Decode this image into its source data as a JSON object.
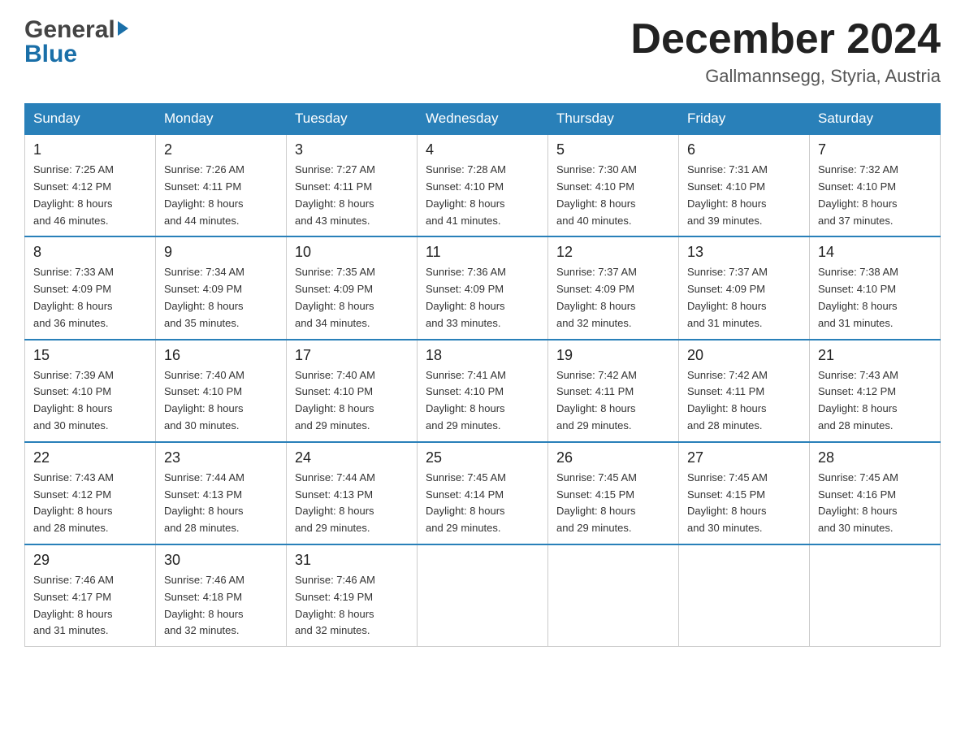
{
  "header": {
    "logo_text1": "General",
    "logo_text2": "Blue",
    "month_title": "December 2024",
    "location": "Gallmannsegg, Styria, Austria"
  },
  "days_of_week": [
    "Sunday",
    "Monday",
    "Tuesday",
    "Wednesday",
    "Thursday",
    "Friday",
    "Saturday"
  ],
  "weeks": [
    [
      {
        "day": "1",
        "sunrise": "7:25 AM",
        "sunset": "4:12 PM",
        "daylight": "8 hours and 46 minutes."
      },
      {
        "day": "2",
        "sunrise": "7:26 AM",
        "sunset": "4:11 PM",
        "daylight": "8 hours and 44 minutes."
      },
      {
        "day": "3",
        "sunrise": "7:27 AM",
        "sunset": "4:11 PM",
        "daylight": "8 hours and 43 minutes."
      },
      {
        "day": "4",
        "sunrise": "7:28 AM",
        "sunset": "4:10 PM",
        "daylight": "8 hours and 41 minutes."
      },
      {
        "day": "5",
        "sunrise": "7:30 AM",
        "sunset": "4:10 PM",
        "daylight": "8 hours and 40 minutes."
      },
      {
        "day": "6",
        "sunrise": "7:31 AM",
        "sunset": "4:10 PM",
        "daylight": "8 hours and 39 minutes."
      },
      {
        "day": "7",
        "sunrise": "7:32 AM",
        "sunset": "4:10 PM",
        "daylight": "8 hours and 37 minutes."
      }
    ],
    [
      {
        "day": "8",
        "sunrise": "7:33 AM",
        "sunset": "4:09 PM",
        "daylight": "8 hours and 36 minutes."
      },
      {
        "day": "9",
        "sunrise": "7:34 AM",
        "sunset": "4:09 PM",
        "daylight": "8 hours and 35 minutes."
      },
      {
        "day": "10",
        "sunrise": "7:35 AM",
        "sunset": "4:09 PM",
        "daylight": "8 hours and 34 minutes."
      },
      {
        "day": "11",
        "sunrise": "7:36 AM",
        "sunset": "4:09 PM",
        "daylight": "8 hours and 33 minutes."
      },
      {
        "day": "12",
        "sunrise": "7:37 AM",
        "sunset": "4:09 PM",
        "daylight": "8 hours and 32 minutes."
      },
      {
        "day": "13",
        "sunrise": "7:37 AM",
        "sunset": "4:09 PM",
        "daylight": "8 hours and 31 minutes."
      },
      {
        "day": "14",
        "sunrise": "7:38 AM",
        "sunset": "4:10 PM",
        "daylight": "8 hours and 31 minutes."
      }
    ],
    [
      {
        "day": "15",
        "sunrise": "7:39 AM",
        "sunset": "4:10 PM",
        "daylight": "8 hours and 30 minutes."
      },
      {
        "day": "16",
        "sunrise": "7:40 AM",
        "sunset": "4:10 PM",
        "daylight": "8 hours and 30 minutes."
      },
      {
        "day": "17",
        "sunrise": "7:40 AM",
        "sunset": "4:10 PM",
        "daylight": "8 hours and 29 minutes."
      },
      {
        "day": "18",
        "sunrise": "7:41 AM",
        "sunset": "4:10 PM",
        "daylight": "8 hours and 29 minutes."
      },
      {
        "day": "19",
        "sunrise": "7:42 AM",
        "sunset": "4:11 PM",
        "daylight": "8 hours and 29 minutes."
      },
      {
        "day": "20",
        "sunrise": "7:42 AM",
        "sunset": "4:11 PM",
        "daylight": "8 hours and 28 minutes."
      },
      {
        "day": "21",
        "sunrise": "7:43 AM",
        "sunset": "4:12 PM",
        "daylight": "8 hours and 28 minutes."
      }
    ],
    [
      {
        "day": "22",
        "sunrise": "7:43 AM",
        "sunset": "4:12 PM",
        "daylight": "8 hours and 28 minutes."
      },
      {
        "day": "23",
        "sunrise": "7:44 AM",
        "sunset": "4:13 PM",
        "daylight": "8 hours and 28 minutes."
      },
      {
        "day": "24",
        "sunrise": "7:44 AM",
        "sunset": "4:13 PM",
        "daylight": "8 hours and 29 minutes."
      },
      {
        "day": "25",
        "sunrise": "7:45 AM",
        "sunset": "4:14 PM",
        "daylight": "8 hours and 29 minutes."
      },
      {
        "day": "26",
        "sunrise": "7:45 AM",
        "sunset": "4:15 PM",
        "daylight": "8 hours and 29 minutes."
      },
      {
        "day": "27",
        "sunrise": "7:45 AM",
        "sunset": "4:15 PM",
        "daylight": "8 hours and 30 minutes."
      },
      {
        "day": "28",
        "sunrise": "7:45 AM",
        "sunset": "4:16 PM",
        "daylight": "8 hours and 30 minutes."
      }
    ],
    [
      {
        "day": "29",
        "sunrise": "7:46 AM",
        "sunset": "4:17 PM",
        "daylight": "8 hours and 31 minutes."
      },
      {
        "day": "30",
        "sunrise": "7:46 AM",
        "sunset": "4:18 PM",
        "daylight": "8 hours and 32 minutes."
      },
      {
        "day": "31",
        "sunrise": "7:46 AM",
        "sunset": "4:19 PM",
        "daylight": "8 hours and 32 minutes."
      },
      null,
      null,
      null,
      null
    ]
  ],
  "labels": {
    "sunrise": "Sunrise:",
    "sunset": "Sunset:",
    "daylight": "Daylight:"
  }
}
